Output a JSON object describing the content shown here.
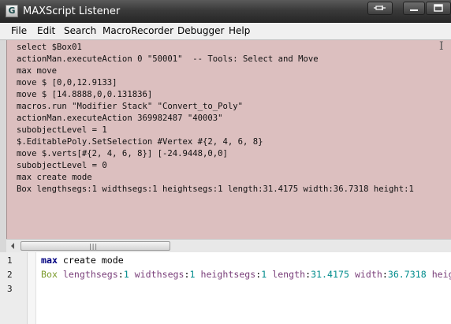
{
  "window": {
    "title": "MAXScript Listener",
    "app_icon_letter": "G",
    "icons": {
      "pin": "pin-icon",
      "minimize": "minimize-icon",
      "maximize": "maximize-icon"
    }
  },
  "menu": [
    {
      "label": "File"
    },
    {
      "label": "Edit"
    },
    {
      "label": "Search"
    },
    {
      "label": "MacroRecorder"
    },
    {
      "label": "Debugger"
    },
    {
      "label": "Help"
    }
  ],
  "output": {
    "background": "#dcbfbf",
    "lines": [
      "select $Box01",
      "actionMan.executeAction 0 \"50001\"  -- Tools: Select and Move",
      "max move",
      "move $ [0,0,12.9133]",
      "move $ [14.8888,0,0.131836]",
      "macros.run \"Modifier Stack\" \"Convert_to_Poly\"",
      "actionMan.executeAction 369982487 \"40003\"",
      "subobjectLevel = 1",
      "$.EditablePoly.SetSelection #Vertex #{2, 4, 6, 8}",
      "move $.verts[#{2, 4, 6, 8}] [-24.9448,0,0]",
      "subobjectLevel = 0",
      "max create mode",
      "Box lengthsegs:1 widthsegs:1 heightsegs:1 length:31.4175 width:36.7318 height:1"
    ]
  },
  "scrollbar": {
    "grip": "|||"
  },
  "editor": {
    "line_numbers": [
      "1",
      "2",
      "3"
    ],
    "line1": {
      "kw": "max",
      "rest": " create mode"
    },
    "line2": {
      "t0": "Box",
      "t1": " lengthsegs",
      "t2": ":",
      "t3": "1",
      "t4": " widthsegs",
      "t5": ":",
      "t6": "1",
      "t7": " heightsegs",
      "t8": ":",
      "t9": "1",
      "t10": " length",
      "t11": ":",
      "t12": "31.4175",
      "t13": " width",
      "t14": ":",
      "t15": "36.7318",
      "t16": " heig"
    }
  },
  "colors": {
    "keyword": "#000080",
    "class": "#7a9a2a",
    "parameter": "#7a3f7a",
    "number": "#008c8c"
  }
}
